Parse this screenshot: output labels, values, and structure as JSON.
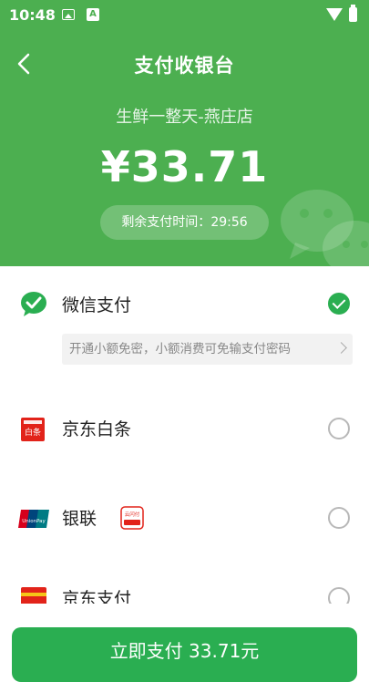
{
  "status_bar": {
    "time": "10:48",
    "icon_a": "A"
  },
  "header": {
    "title": "支付收银台",
    "merchant": "生鲜一整天-燕庄店",
    "amount": "¥33.71",
    "countdown_label": "剩余支付时间：",
    "countdown_value": "29:56"
  },
  "payment_methods": [
    {
      "label": "微信支付",
      "icon": "wechat-pay-icon",
      "selected": true,
      "promo": "开通小额免密，小额消费可免输支付密码"
    },
    {
      "label": "京东白条",
      "icon": "jd-baitiao-icon",
      "icon_text": "白条",
      "selected": false
    },
    {
      "label": "银联",
      "icon": "unionpay-icon",
      "icon_text": "UnionPay",
      "badge_text": "云闪付",
      "selected": false
    },
    {
      "label": "京东支付",
      "icon": "jd-pay-icon",
      "selected": false
    }
  ],
  "pay_button": {
    "label": "立即支付 33.71元"
  },
  "colors": {
    "primary_green": "#4caf50",
    "button_green": "#2aae51"
  }
}
